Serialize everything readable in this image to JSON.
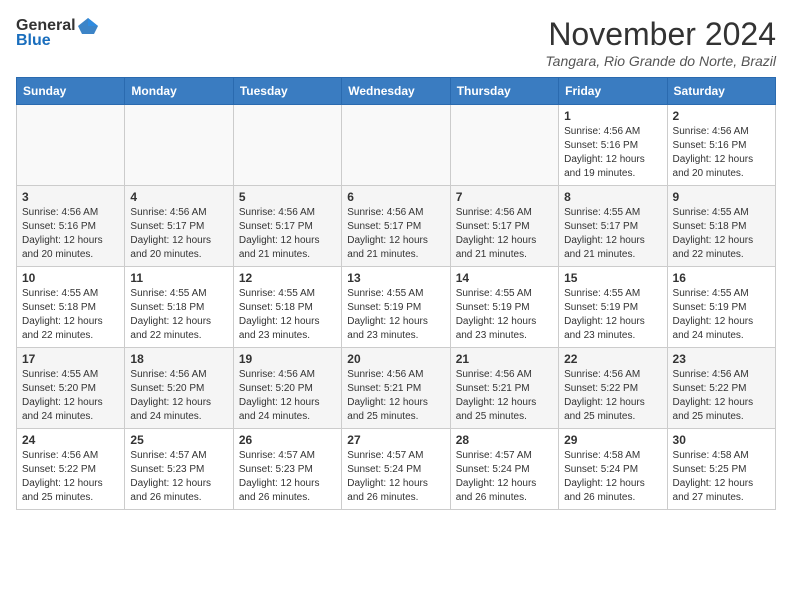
{
  "header": {
    "logo_general": "General",
    "logo_blue": "Blue",
    "month_title": "November 2024",
    "location": "Tangara, Rio Grande do Norte, Brazil"
  },
  "days_of_week": [
    "Sunday",
    "Monday",
    "Tuesday",
    "Wednesday",
    "Thursday",
    "Friday",
    "Saturday"
  ],
  "weeks": [
    {
      "days": [
        {
          "num": "",
          "info": ""
        },
        {
          "num": "",
          "info": ""
        },
        {
          "num": "",
          "info": ""
        },
        {
          "num": "",
          "info": ""
        },
        {
          "num": "",
          "info": ""
        },
        {
          "num": "1",
          "info": "Sunrise: 4:56 AM\nSunset: 5:16 PM\nDaylight: 12 hours\nand 19 minutes."
        },
        {
          "num": "2",
          "info": "Sunrise: 4:56 AM\nSunset: 5:16 PM\nDaylight: 12 hours\nand 20 minutes."
        }
      ]
    },
    {
      "days": [
        {
          "num": "3",
          "info": "Sunrise: 4:56 AM\nSunset: 5:16 PM\nDaylight: 12 hours\nand 20 minutes."
        },
        {
          "num": "4",
          "info": "Sunrise: 4:56 AM\nSunset: 5:17 PM\nDaylight: 12 hours\nand 20 minutes."
        },
        {
          "num": "5",
          "info": "Sunrise: 4:56 AM\nSunset: 5:17 PM\nDaylight: 12 hours\nand 21 minutes."
        },
        {
          "num": "6",
          "info": "Sunrise: 4:56 AM\nSunset: 5:17 PM\nDaylight: 12 hours\nand 21 minutes."
        },
        {
          "num": "7",
          "info": "Sunrise: 4:56 AM\nSunset: 5:17 PM\nDaylight: 12 hours\nand 21 minutes."
        },
        {
          "num": "8",
          "info": "Sunrise: 4:55 AM\nSunset: 5:17 PM\nDaylight: 12 hours\nand 21 minutes."
        },
        {
          "num": "9",
          "info": "Sunrise: 4:55 AM\nSunset: 5:18 PM\nDaylight: 12 hours\nand 22 minutes."
        }
      ]
    },
    {
      "days": [
        {
          "num": "10",
          "info": "Sunrise: 4:55 AM\nSunset: 5:18 PM\nDaylight: 12 hours\nand 22 minutes."
        },
        {
          "num": "11",
          "info": "Sunrise: 4:55 AM\nSunset: 5:18 PM\nDaylight: 12 hours\nand 22 minutes."
        },
        {
          "num": "12",
          "info": "Sunrise: 4:55 AM\nSunset: 5:18 PM\nDaylight: 12 hours\nand 23 minutes."
        },
        {
          "num": "13",
          "info": "Sunrise: 4:55 AM\nSunset: 5:19 PM\nDaylight: 12 hours\nand 23 minutes."
        },
        {
          "num": "14",
          "info": "Sunrise: 4:55 AM\nSunset: 5:19 PM\nDaylight: 12 hours\nand 23 minutes."
        },
        {
          "num": "15",
          "info": "Sunrise: 4:55 AM\nSunset: 5:19 PM\nDaylight: 12 hours\nand 23 minutes."
        },
        {
          "num": "16",
          "info": "Sunrise: 4:55 AM\nSunset: 5:19 PM\nDaylight: 12 hours\nand 24 minutes."
        }
      ]
    },
    {
      "days": [
        {
          "num": "17",
          "info": "Sunrise: 4:55 AM\nSunset: 5:20 PM\nDaylight: 12 hours\nand 24 minutes."
        },
        {
          "num": "18",
          "info": "Sunrise: 4:56 AM\nSunset: 5:20 PM\nDaylight: 12 hours\nand 24 minutes."
        },
        {
          "num": "19",
          "info": "Sunrise: 4:56 AM\nSunset: 5:20 PM\nDaylight: 12 hours\nand 24 minutes."
        },
        {
          "num": "20",
          "info": "Sunrise: 4:56 AM\nSunset: 5:21 PM\nDaylight: 12 hours\nand 25 minutes."
        },
        {
          "num": "21",
          "info": "Sunrise: 4:56 AM\nSunset: 5:21 PM\nDaylight: 12 hours\nand 25 minutes."
        },
        {
          "num": "22",
          "info": "Sunrise: 4:56 AM\nSunset: 5:22 PM\nDaylight: 12 hours\nand 25 minutes."
        },
        {
          "num": "23",
          "info": "Sunrise: 4:56 AM\nSunset: 5:22 PM\nDaylight: 12 hours\nand 25 minutes."
        }
      ]
    },
    {
      "days": [
        {
          "num": "24",
          "info": "Sunrise: 4:56 AM\nSunset: 5:22 PM\nDaylight: 12 hours\nand 25 minutes."
        },
        {
          "num": "25",
          "info": "Sunrise: 4:57 AM\nSunset: 5:23 PM\nDaylight: 12 hours\nand 26 minutes."
        },
        {
          "num": "26",
          "info": "Sunrise: 4:57 AM\nSunset: 5:23 PM\nDaylight: 12 hours\nand 26 minutes."
        },
        {
          "num": "27",
          "info": "Sunrise: 4:57 AM\nSunset: 5:24 PM\nDaylight: 12 hours\nand 26 minutes."
        },
        {
          "num": "28",
          "info": "Sunrise: 4:57 AM\nSunset: 5:24 PM\nDaylight: 12 hours\nand 26 minutes."
        },
        {
          "num": "29",
          "info": "Sunrise: 4:58 AM\nSunset: 5:24 PM\nDaylight: 12 hours\nand 26 minutes."
        },
        {
          "num": "30",
          "info": "Sunrise: 4:58 AM\nSunset: 5:25 PM\nDaylight: 12 hours\nand 27 minutes."
        }
      ]
    }
  ]
}
